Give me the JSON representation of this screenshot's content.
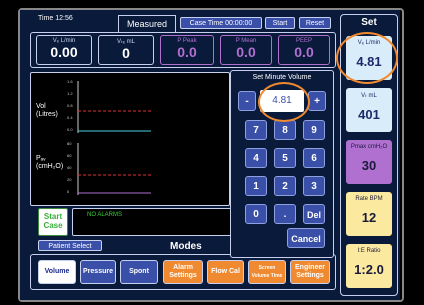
{
  "topbar": {
    "time": "Time 12:56",
    "measured_tab": "Measured",
    "case_time": "Case Time 00:00:00",
    "start": "Start",
    "reset": "Reset"
  },
  "measured": [
    {
      "label": "Vₑ L/min",
      "value": "0.00",
      "color": "#c8d0f0"
    },
    {
      "label": "Vₜₑ mL",
      "value": "0",
      "color": "#c8d0f0"
    },
    {
      "label": "P Peak",
      "value": "0.0",
      "color": "#b070d0"
    },
    {
      "label": "P Mean",
      "value": "0.0",
      "color": "#b070d0"
    },
    {
      "label": "PEEP",
      "value": "0.0",
      "color": "#b070d0"
    }
  ],
  "plots": {
    "vol_label_1": "Vol",
    "vol_label_2": "(Litres)",
    "vol_ticks": [
      "1.6",
      "1.2",
      "0.8",
      "0.4",
      "0.0"
    ],
    "paw_label_1": "Pₐᵥ",
    "paw_label_2": "(cmH₂O)",
    "paw_ticks": [
      "80",
      "60",
      "40",
      "20",
      "0"
    ]
  },
  "keypad": {
    "title": "Set Minute Volume",
    "value": "4.81",
    "minus": "-",
    "plus": "+",
    "keys": [
      "7",
      "8",
      "9",
      "4",
      "5",
      "6",
      "1",
      "2",
      "3",
      "0",
      ".",
      "Del"
    ],
    "cancel": "Cancel"
  },
  "alarms": {
    "start_case_1": "Start",
    "start_case_2": "Case",
    "text": "NO ALARMS"
  },
  "patient_select": "Patient Select",
  "modes_title": "Modes",
  "modes": [
    {
      "label": "Volume",
      "bg": "#ffffff",
      "fg": "#1a2a8a"
    },
    {
      "label": "Pressure",
      "bg": "#3a4fa8",
      "fg": "#ffffff"
    },
    {
      "label": "Spont",
      "bg": "#3a4fa8",
      "fg": "#ffffff"
    },
    {
      "label": "Alarm Settings",
      "bg": "#f08a30",
      "fg": "#ffffff"
    },
    {
      "label": "Flow Cal",
      "bg": "#f08a30",
      "fg": "#ffffff"
    },
    {
      "label": "Screen Volume Time",
      "bg": "#f08a30",
      "fg": "#ffffff"
    },
    {
      "label": "Engineer Settings",
      "bg": "#f08a30",
      "fg": "#ffffff"
    }
  ],
  "set_panel": {
    "title": "Set",
    "tiles": [
      {
        "label": "Vₑ L/min",
        "value": "4.81",
        "bg": "#d8ecfa",
        "fg": "#1a2a6a"
      },
      {
        "label": "Vₜ mL",
        "value": "401",
        "bg": "#d8ecfa",
        "fg": "#1a2a6a"
      },
      {
        "label": "Pmax cmH₂O",
        "value": "30",
        "bg": "#b070d0",
        "fg": "#1a1a3a"
      },
      {
        "label": "Rate BPM",
        "value": "12",
        "bg": "#fbe9a0",
        "fg": "#1a1a3a"
      },
      {
        "label": "I:E Ratio",
        "value": "1:2.0",
        "bg": "#fbe9a0",
        "fg": "#1a1a3a"
      }
    ]
  }
}
